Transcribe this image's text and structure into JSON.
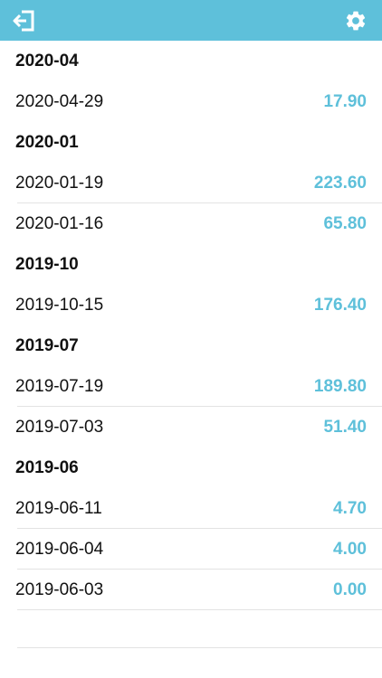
{
  "toolbar": {
    "left_icon": "exit-icon",
    "right_icon": "gear-icon"
  },
  "colors": {
    "accent": "#5ec0da",
    "separator": "#e3e3e3"
  },
  "groups": [
    {
      "month": "2020-04",
      "rows": [
        {
          "date": "2020-04-29",
          "amount": "17.90"
        }
      ]
    },
    {
      "month": "2020-01",
      "rows": [
        {
          "date": "2020-01-19",
          "amount": "223.60"
        },
        {
          "date": "2020-01-16",
          "amount": "65.80"
        }
      ]
    },
    {
      "month": "2019-10",
      "rows": [
        {
          "date": "2019-10-15",
          "amount": "176.40"
        }
      ]
    },
    {
      "month": "2019-07",
      "rows": [
        {
          "date": "2019-07-19",
          "amount": "189.80"
        },
        {
          "date": "2019-07-03",
          "amount": "51.40"
        }
      ]
    },
    {
      "month": "2019-06",
      "rows": [
        {
          "date": "2019-06-11",
          "amount": "4.70"
        },
        {
          "date": "2019-06-04",
          "amount": "4.00"
        },
        {
          "date": "2019-06-03",
          "amount": "0.00"
        }
      ]
    }
  ]
}
